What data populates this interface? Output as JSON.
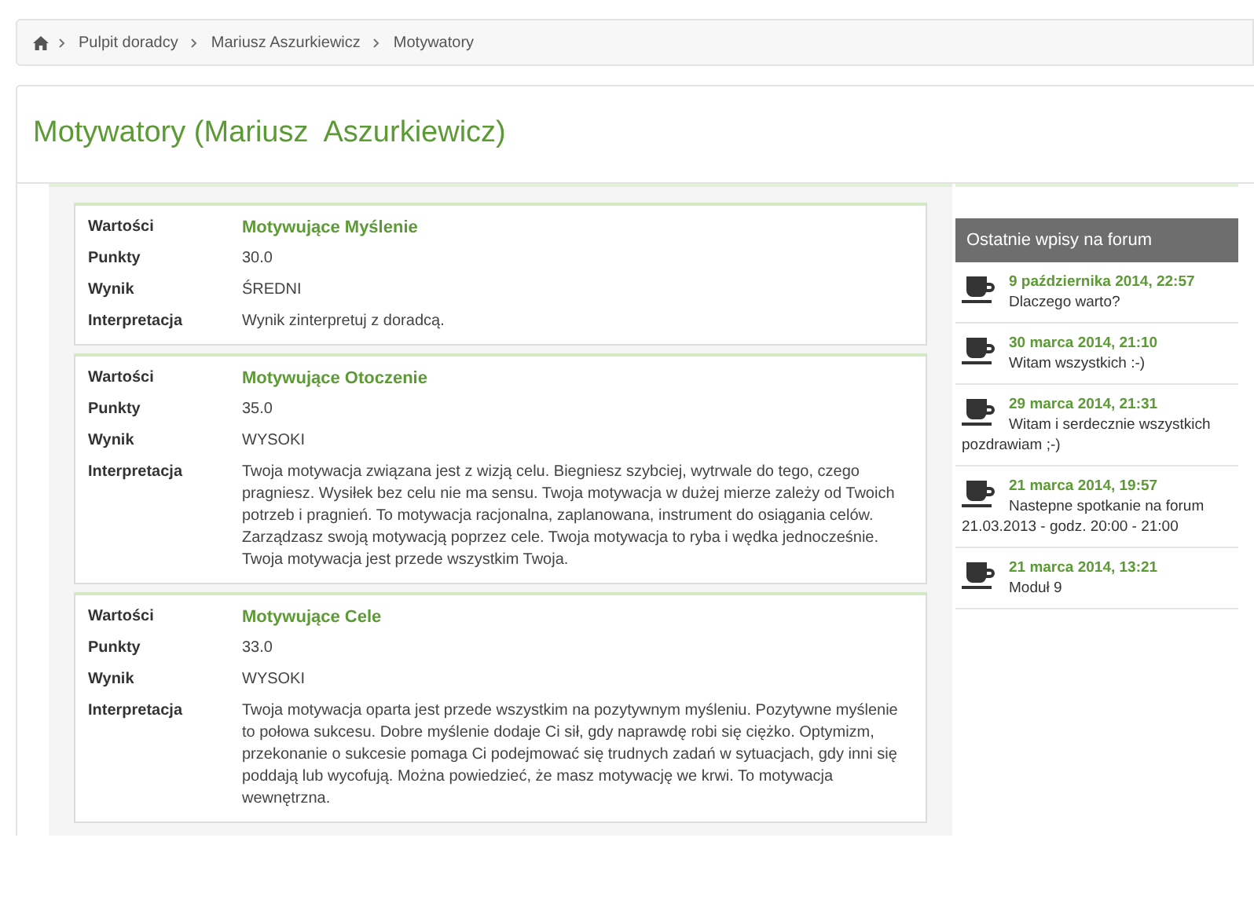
{
  "breadcrumb": [
    "Pulpit doradcy",
    "Mariusz Aszurkiewicz",
    "Motywatory"
  ],
  "title": "Motywatory (Mariusz  Aszurkiewicz)",
  "results": [
    {
      "rows": [
        {
          "label": "Wartości",
          "value": "Motywujące Myślenie",
          "kind": "heading"
        },
        {
          "label": "Punkty",
          "value": "30.0",
          "kind": "text"
        },
        {
          "label": "Wynik",
          "value": "ŚREDNI",
          "kind": "text"
        },
        {
          "label": "Interpretacja",
          "value": "Wynik zinterpretuj z doradcą.",
          "kind": "text"
        }
      ]
    },
    {
      "rows": [
        {
          "label": "Wartości",
          "value": "Motywujące Otoczenie",
          "kind": "heading"
        },
        {
          "label": "Punkty",
          "value": "35.0",
          "kind": "text"
        },
        {
          "label": "Wynik",
          "value": "WYSOKI",
          "kind": "text"
        },
        {
          "label": "Interpretacja",
          "value": "Twoja motywacja związana jest z wizją celu. Biegniesz szybciej, wytrwale do tego, czego pragniesz. Wysiłek bez celu nie ma sensu. Twoja motywacja w dużej mierze zależy od Twoich potrzeb i pragnień. To motywacja racjonalna, zaplanowana, instrument do osiągania celów. Zarządzasz swoją motywacją poprzez cele. Twoja motywacja to ryba i wędka jednocześnie. Twoja motywacja jest przede wszystkim Twoja.",
          "kind": "text"
        }
      ]
    },
    {
      "rows": [
        {
          "label": "Wartości",
          "value": "Motywujące Cele",
          "kind": "heading"
        },
        {
          "label": "Punkty",
          "value": "33.0",
          "kind": "text"
        },
        {
          "label": "Wynik",
          "value": "WYSOKI",
          "kind": "text"
        },
        {
          "label": "Interpretacja",
          "value": "Twoja motywacja oparta jest przede wszystkim na pozytywnym myśleniu. Pozytywne myślenie to połowa sukcesu. Dobre myślenie dodaje Ci sił, gdy naprawdę robi się ciężko. Optymizm, przekonanie o sukcesie pomaga Ci podejmować się trudnych zadań w sytuacjach, gdy inni się poddają lub wycofują. Można powiedzieć, że masz motywację we krwi. To motywacja wewnętrzna.",
          "kind": "text"
        }
      ]
    }
  ],
  "forum": {
    "title": "Ostatnie wpisy na forum",
    "posts": [
      {
        "date": "9 października 2014, 22:57",
        "text": "Dlaczego warto?"
      },
      {
        "date": "30 marca 2014, 21:10",
        "text": "Witam wszystkich :-)"
      },
      {
        "date": "29 marca 2014, 21:31",
        "text": "Witam i serdecznie wszystkich pozdrawiam ;-)"
      },
      {
        "date": "21 marca 2014, 19:57",
        "text": "Nastepne spotkanie na forum 21.03.2013 - godz. 20:00 - 21:00"
      },
      {
        "date": "21 marca 2014, 13:21",
        "text": "Moduł 9"
      }
    ]
  }
}
